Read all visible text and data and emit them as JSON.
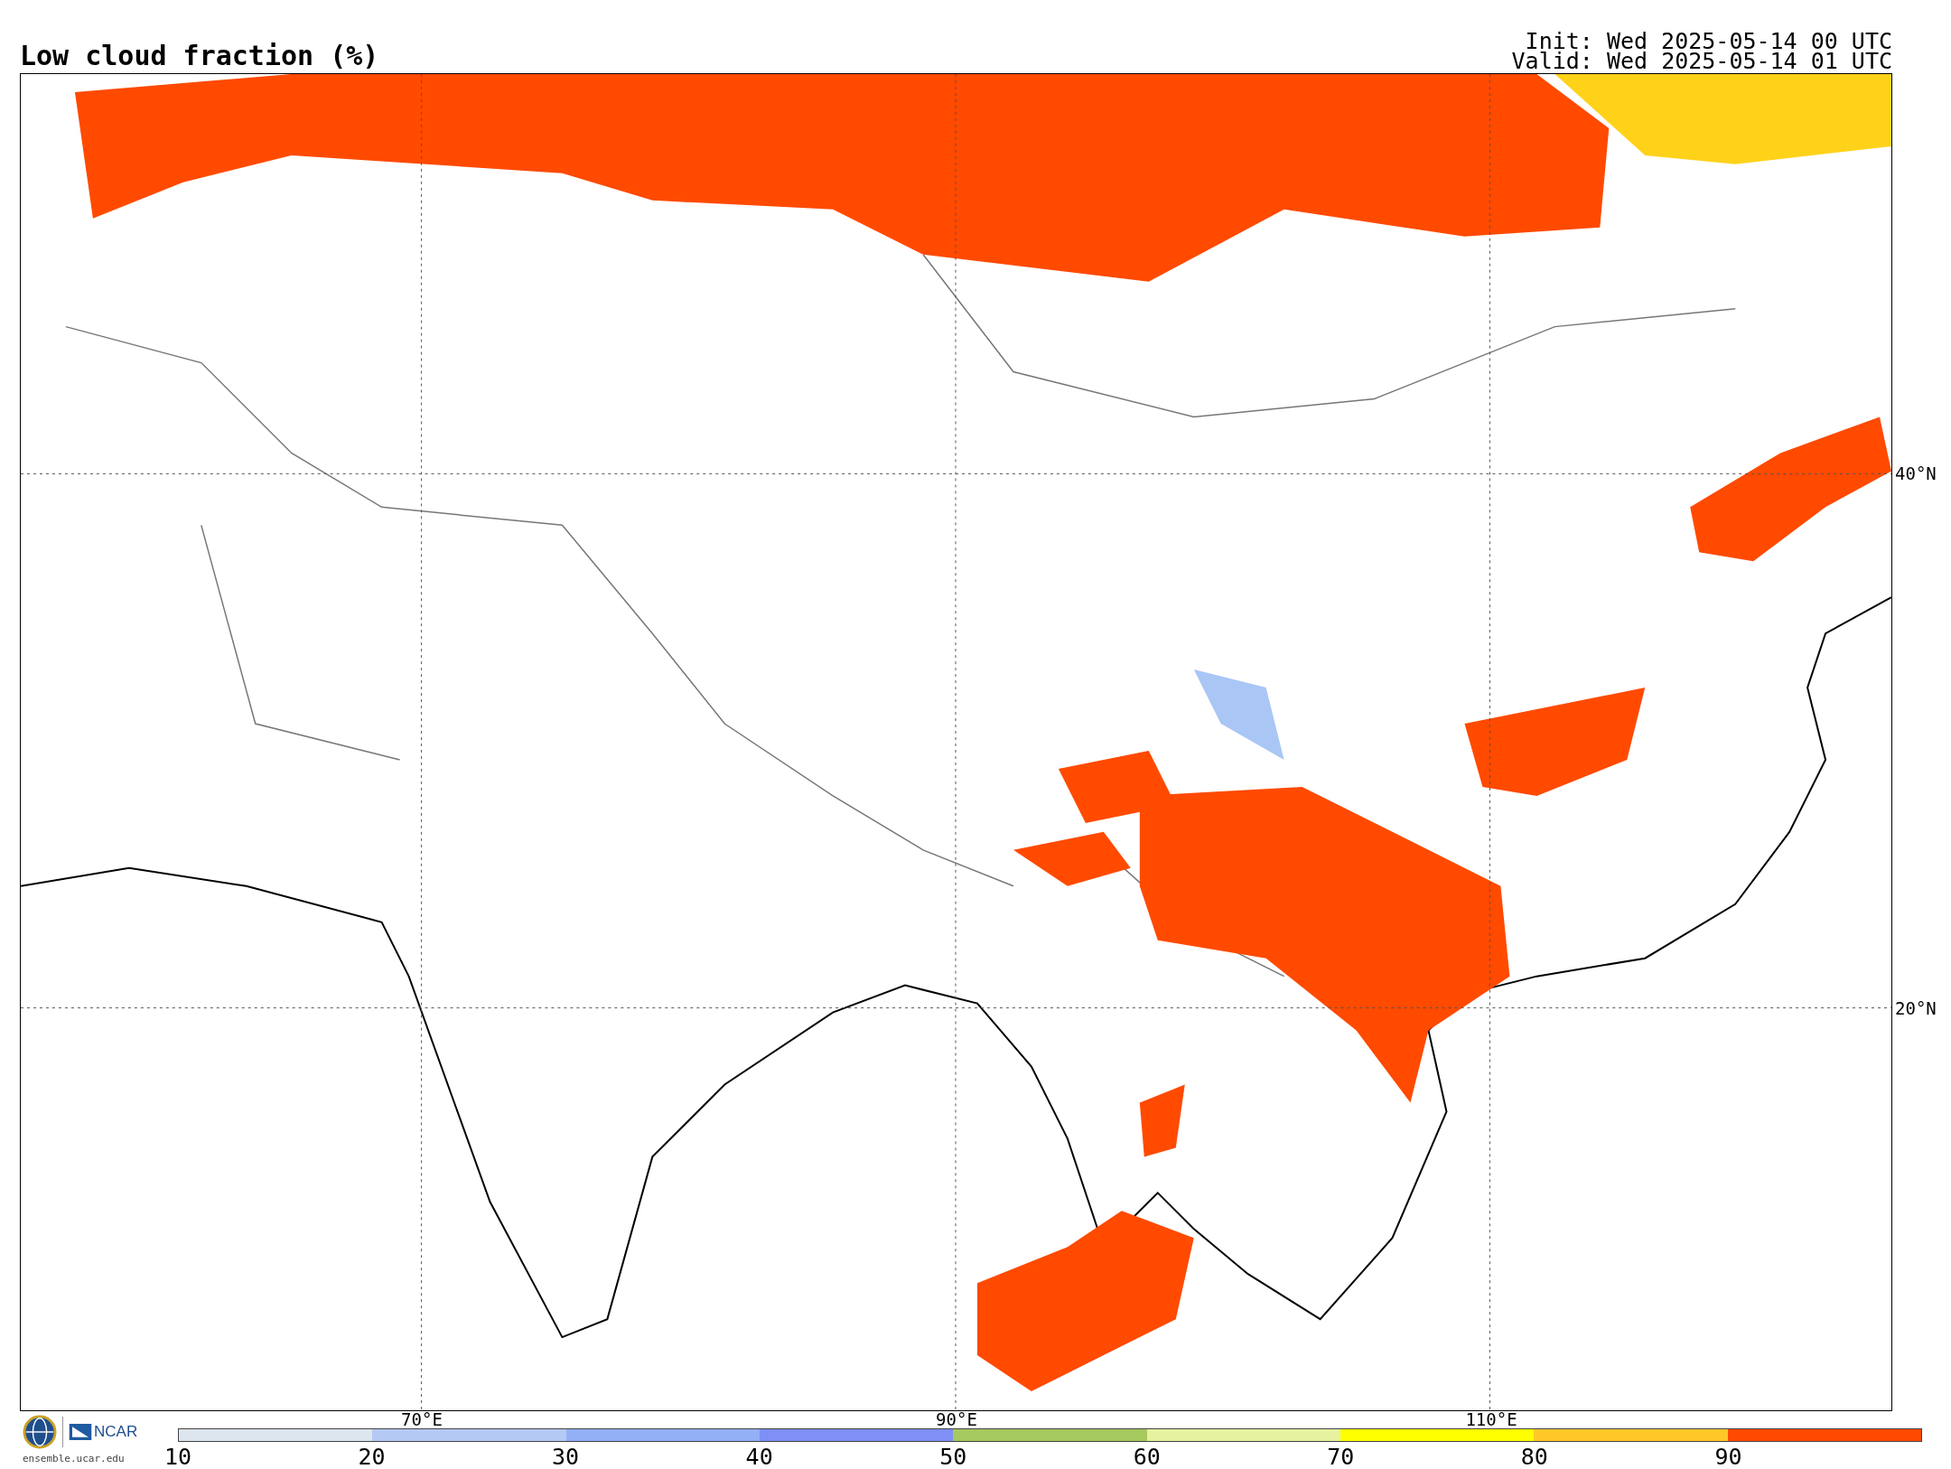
{
  "title": "Low cloud fraction (%)",
  "init": "Init: Wed 2025-05-14 00 UTC",
  "valid": "Valid: Wed 2025-05-14 01 UTC",
  "map": {
    "lat_labels": [
      "40°N",
      "20°N"
    ],
    "lon_labels": [
      "70°E",
      "90°E",
      "110°E"
    ]
  },
  "colorbar": {
    "segments": [
      {
        "color": "#dde6ee"
      },
      {
        "color": "#b5c9f5"
      },
      {
        "color": "#93b0f7"
      },
      {
        "color": "#7f8ff5"
      },
      {
        "color": "#a6c95e"
      },
      {
        "color": "#e6f2a0"
      },
      {
        "color": "#ffff00"
      },
      {
        "color": "#ffc72a"
      },
      {
        "color": "#ff4a00"
      }
    ],
    "tick_labels": [
      "10",
      "20",
      "30",
      "40",
      "50",
      "60",
      "70",
      "80",
      "90"
    ]
  },
  "logo": {
    "name": "NCAR",
    "url": "ensemble.ucar.edu"
  }
}
